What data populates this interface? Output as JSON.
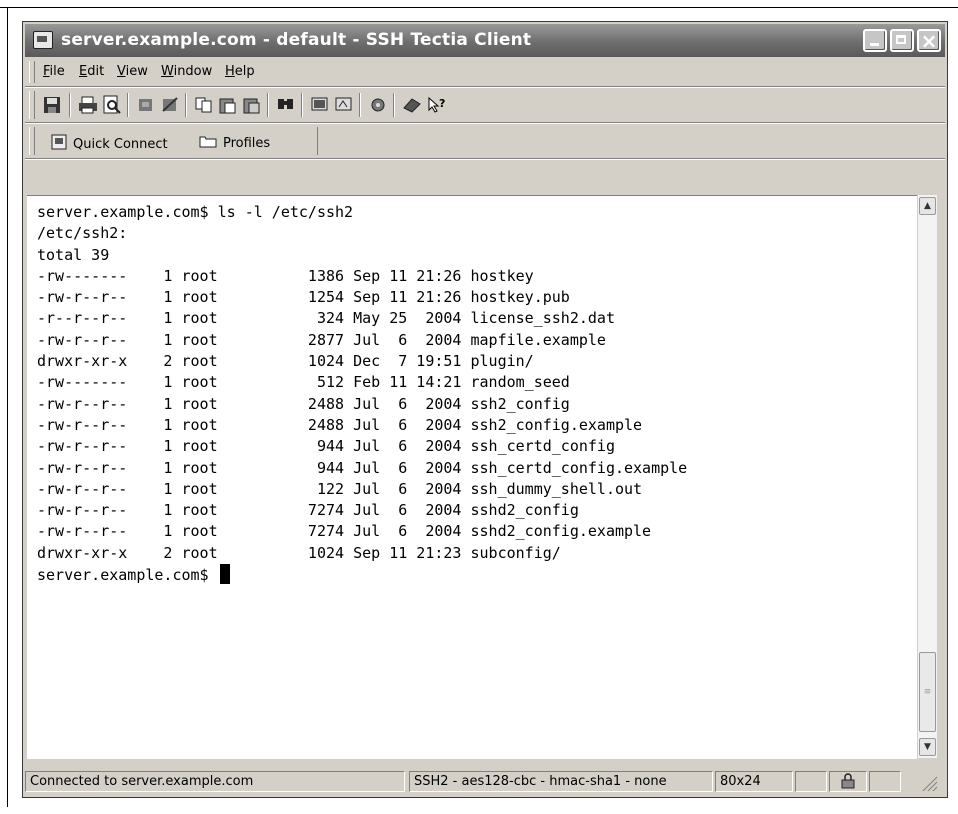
{
  "window": {
    "title": "server.example.com - default - SSH Tectia Client"
  },
  "menu": {
    "items": [
      {
        "label": "File",
        "accel": "F",
        "rest": "ile"
      },
      {
        "label": "Edit",
        "accel": "E",
        "rest": "dit"
      },
      {
        "label": "View",
        "accel": "V",
        "rest": "iew"
      },
      {
        "label": "Window",
        "accel": "W",
        "rest": "indow"
      },
      {
        "label": "Help",
        "accel": "H",
        "rest": "elp"
      }
    ]
  },
  "toolbar": {
    "icons": [
      "save-icon",
      "print-icon",
      "print-preview-icon",
      "disconnect-icon",
      "reconnect-icon",
      "copy-icon",
      "paste-icon",
      "paste-special-icon",
      "find-icon",
      "new-terminal-icon",
      "new-file-transfer-icon",
      "settings-icon",
      "help-book-icon",
      "context-help-icon"
    ]
  },
  "quickbar": {
    "quick_connect": "Quick Connect",
    "profiles": "Profiles"
  },
  "terminal": {
    "lines": [
      "server.example.com$ ls -l /etc/ssh2",
      "/etc/ssh2:",
      "total 39",
      "-rw-------    1 root          1386 Sep 11 21:26 hostkey",
      "-rw-r--r--    1 root          1254 Sep 11 21:26 hostkey.pub",
      "-r--r--r--    1 root           324 May 25  2004 license_ssh2.dat",
      "-rw-r--r--    1 root          2877 Jul  6  2004 mapfile.example",
      "drwxr-xr-x    2 root          1024 Dec  7 19:51 plugin/",
      "-rw-------    1 root           512 Feb 11 14:21 random_seed",
      "-rw-r--r--    1 root          2488 Jul  6  2004 ssh2_config",
      "-rw-r--r--    1 root          2488 Jul  6  2004 ssh2_config.example",
      "-rw-r--r--    1 root           944 Jul  6  2004 ssh_certd_config",
      "-rw-r--r--    1 root           944 Jul  6  2004 ssh_certd_config.example",
      "-rw-r--r--    1 root           122 Jul  6  2004 ssh_dummy_shell.out",
      "-rw-r--r--    1 root          7274 Jul  6  2004 sshd2_config",
      "-rw-r--r--    1 root          7274 Jul  6  2004 sshd2_config.example",
      "drwxr-xr-x    2 root          1024 Sep 11 21:23 subconfig/"
    ],
    "prompt": "server.example.com$ "
  },
  "status": {
    "connection": "Connected to server.example.com",
    "cipher": "SSH2 - aes128-cbc - hmac-sha1 - none",
    "size": "80x24"
  }
}
